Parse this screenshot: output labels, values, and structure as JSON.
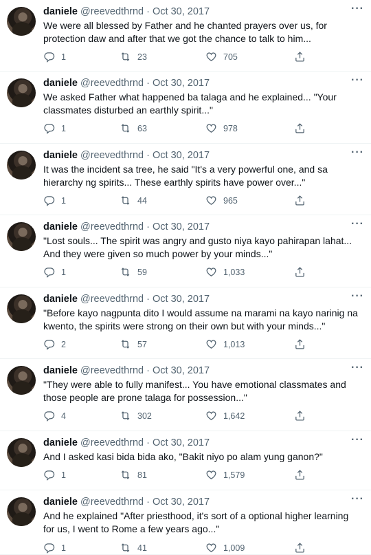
{
  "tweets": [
    {
      "name": "daniele",
      "handle": "@reevedthrnd",
      "separator": "·",
      "date": "Oct 30, 2017",
      "text": "We were all blessed by Father and he chanted prayers over us, for protection daw and after that we got the chance to talk to him...",
      "replies": "1",
      "retweets": "23",
      "likes": "705"
    },
    {
      "name": "daniele",
      "handle": "@reevedthrnd",
      "separator": "·",
      "date": "Oct 30, 2017",
      "text": "We asked Father what happened ba talaga and he explained... \"Your classmates disturbed an earthly spirit...\"",
      "replies": "1",
      "retweets": "63",
      "likes": "978"
    },
    {
      "name": "daniele",
      "handle": "@reevedthrnd",
      "separator": "·",
      "date": "Oct 30, 2017",
      "text": "It was the incident sa tree, he said \"It's a very powerful one, and sa hierarchy ng spirits... These earthly spirits have power over...\"",
      "replies": "1",
      "retweets": "44",
      "likes": "965"
    },
    {
      "name": "daniele",
      "handle": "@reevedthrnd",
      "separator": "·",
      "date": "Oct 30, 2017",
      "text": "\"Lost souls... The spirit was angry and gusto niya kayo pahirapan lahat... And they were given so much power by your minds...\"",
      "replies": "1",
      "retweets": "59",
      "likes": "1,033"
    },
    {
      "name": "daniele",
      "handle": "@reevedthrnd",
      "separator": "·",
      "date": "Oct 30, 2017",
      "text": "\"Before kayo nagpunta dito I would assume na marami na kayo narinig na kwento, the spirits were strong on their own but with your minds...\"",
      "replies": "2",
      "retweets": "57",
      "likes": "1,013"
    },
    {
      "name": "daniele",
      "handle": "@reevedthrnd",
      "separator": "·",
      "date": "Oct 30, 2017",
      "text": "\"They were able to fully manifest... You have emotional classmates and those people are prone talaga for possession...\"",
      "replies": "4",
      "retweets": "302",
      "likes": "1,642"
    },
    {
      "name": "daniele",
      "handle": "@reevedthrnd",
      "separator": "·",
      "date": "Oct 30, 2017",
      "text": "And I asked kasi bida bida ako, \"Bakit niyo po alam yung ganon?\"",
      "replies": "1",
      "retweets": "81",
      "likes": "1,579"
    },
    {
      "name": "daniele",
      "handle": "@reevedthrnd",
      "separator": "·",
      "date": "Oct 30, 2017",
      "text": "And he explained \"After priesthood, it's sort of a optional higher learning for us, I went to Rome a few years ago...\"",
      "replies": "1",
      "retweets": "41",
      "likes": "1,009"
    }
  ],
  "icons": {
    "reply": "reply-icon",
    "retweet": "retweet-icon",
    "like": "heart-icon",
    "share": "share-icon",
    "more": "more-icon"
  },
  "colors": {
    "text": "#0f1419",
    "secondary": "#536471",
    "divider": "#eff3f4"
  }
}
